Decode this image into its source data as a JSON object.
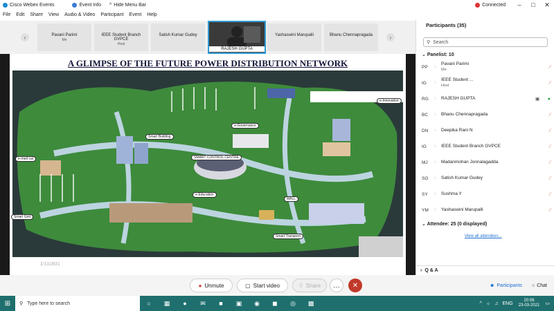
{
  "titlebar": {
    "app_title": "Cisco Webex Events",
    "event_info": "Event Info",
    "hide_menu_bar": "Hide Menu Bar",
    "connected": "Connected"
  },
  "menu": {
    "items": [
      "File",
      "Edit",
      "Share",
      "View",
      "Audio & Video",
      "Participant",
      "Event",
      "Help"
    ]
  },
  "strip": {
    "tiles": [
      {
        "name": "Pavani Parimi",
        "role": "Me"
      },
      {
        "name": "IEEE Student Branch GVPCE",
        "role": "Host"
      },
      {
        "name": "Satish Kumar Gudey",
        "role": ""
      },
      {
        "name": "Yashaswini Marupalli",
        "role": ""
      },
      {
        "name": "Bhanu Chennapragada",
        "role": ""
      }
    ],
    "active_video_name": "RAJESH GUPTA"
  },
  "slide": {
    "title": "A GLIMPSE OF THE FUTURE POWER DISTRIBUTION NETWORK",
    "date": "3/13/2015",
    "labels": [
      "e-Governance",
      "Smart Building",
      "SMART CONTROL CENTRE",
      "e-med cal",
      "e-Education",
      "Smart Grid",
      "MALL",
      "Smart Transport",
      "e-Innovation"
    ]
  },
  "controls": {
    "unmute": "Unmute",
    "start_video": "Start video",
    "share": "Share",
    "more": "…",
    "end": "✕"
  },
  "panel": {
    "title": "Participants (35)",
    "search_placeholder": "Search",
    "panelist_header": "Panelist: 10",
    "panelists": [
      {
        "initials": "PP",
        "name": "Pavani Parimi",
        "role": "Me"
      },
      {
        "initials": "IG",
        "name": "IEEE Student ...",
        "role": "Host"
      },
      {
        "initials": "RG",
        "name": "RAJESH GUPTA",
        "role": ""
      },
      {
        "initials": "BC",
        "name": "Bhanu Chennapragada",
        "role": ""
      },
      {
        "initials": "DN",
        "name": "Deepika Rani N",
        "role": ""
      },
      {
        "initials": "IG",
        "name": "IEEE Student Branch GVPCE",
        "role": ""
      },
      {
        "initials": "MJ",
        "name": "Madanmohan Jonnalagadda",
        "role": ""
      },
      {
        "initials": "SG",
        "name": "Satish Kumar Gudey",
        "role": ""
      },
      {
        "initials": "SY",
        "name": "Sushma Y",
        "role": ""
      },
      {
        "initials": "YM",
        "name": "Yashaswini Marupalli",
        "role": ""
      }
    ],
    "attendee_header": "Attendee: 25 (0 displayed)",
    "view_all": "View all attendees...",
    "qa": "Q & A",
    "participants_btn": "Participants",
    "chat_btn": "Chat"
  },
  "taskbar": {
    "search_placeholder": "Type here to search",
    "lang": "ENG",
    "time": "20:06",
    "date": "23-03-2021"
  },
  "colors": {
    "accent": "#2f9bd4",
    "end_red": "#c0392b",
    "taskbar": "#1f6f6e",
    "title_navy": "#15153a"
  }
}
